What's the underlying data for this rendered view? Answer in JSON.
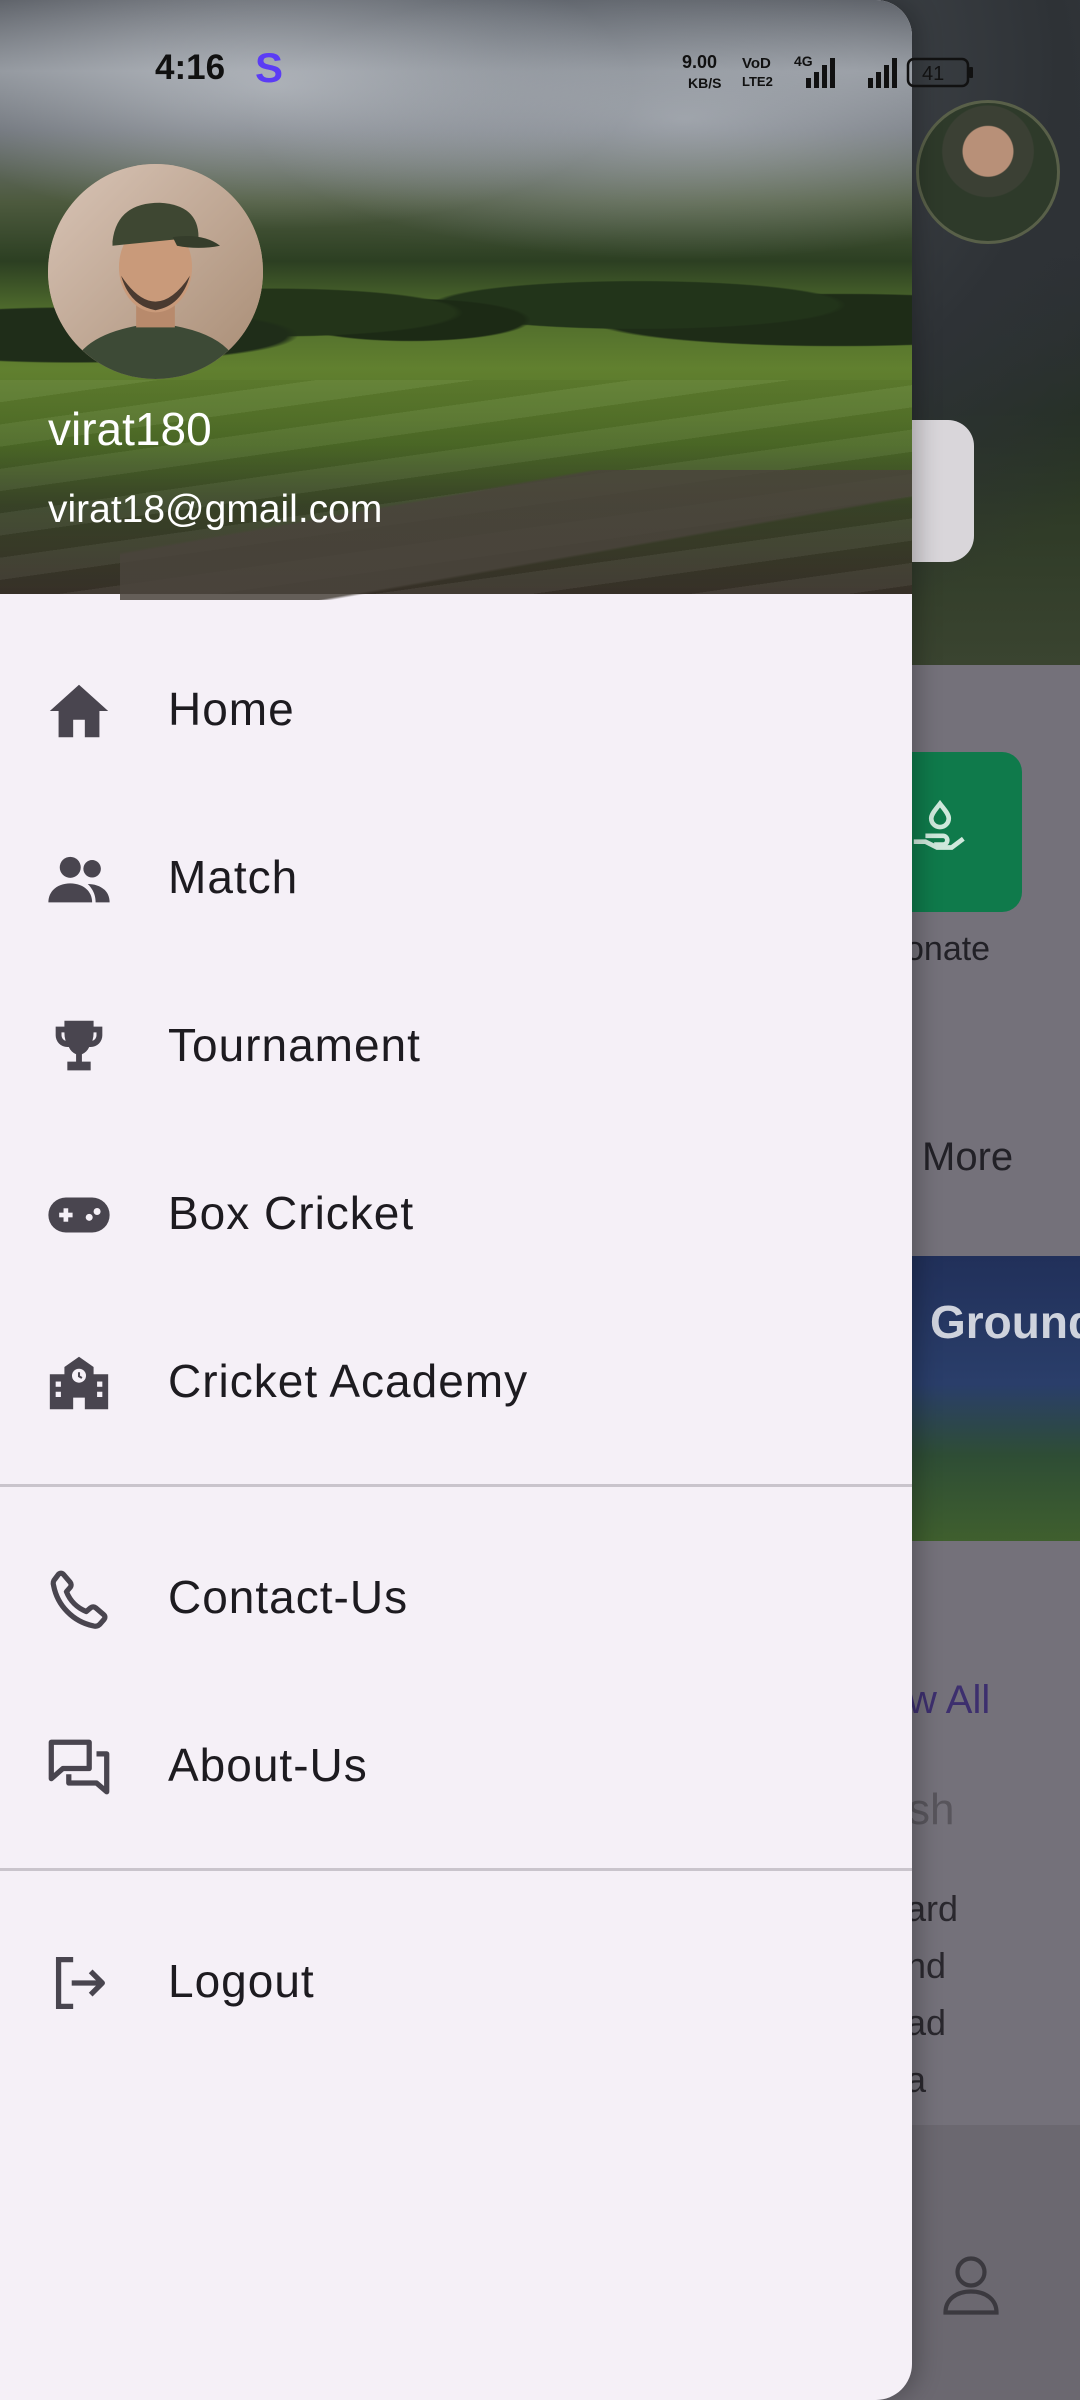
{
  "status_bar": {
    "time": "4:16",
    "app_indicator": "S",
    "net_speed_top": "9.00",
    "net_speed_bottom": "KB/S",
    "volte_top": "VoD",
    "volte_bottom": "LTE2",
    "network": "4G",
    "battery": "41"
  },
  "drawer": {
    "username": "virat180",
    "email": "virat18@gmail.com",
    "primary_items": [
      {
        "label": "Home",
        "icon": "home-icon"
      },
      {
        "label": "Match",
        "icon": "people-icon"
      },
      {
        "label": "Tournament",
        "icon": "trophy-icon"
      },
      {
        "label": "Box Cricket",
        "icon": "gamepad-icon"
      },
      {
        "label": "Cricket Academy",
        "icon": "school-icon"
      }
    ],
    "secondary_items": [
      {
        "label": "Contact-Us",
        "icon": "phone-icon"
      },
      {
        "label": "About-Us",
        "icon": "forum-icon"
      }
    ],
    "logout": {
      "label": "Logout",
      "icon": "logout-icon"
    }
  },
  "background": {
    "donate_label": "onate",
    "more_label": "More",
    "banner_text": "Ground",
    "view_all": "w All",
    "fresh_text": "sh",
    "lines": [
      "ard",
      "nd",
      "ad",
      "a"
    ]
  },
  "colors": {
    "drawer_bg": "#f5f0f7",
    "text": "#1d1b20",
    "accent": "#5b3cf5",
    "donate_tile": "#0f7a4b"
  }
}
